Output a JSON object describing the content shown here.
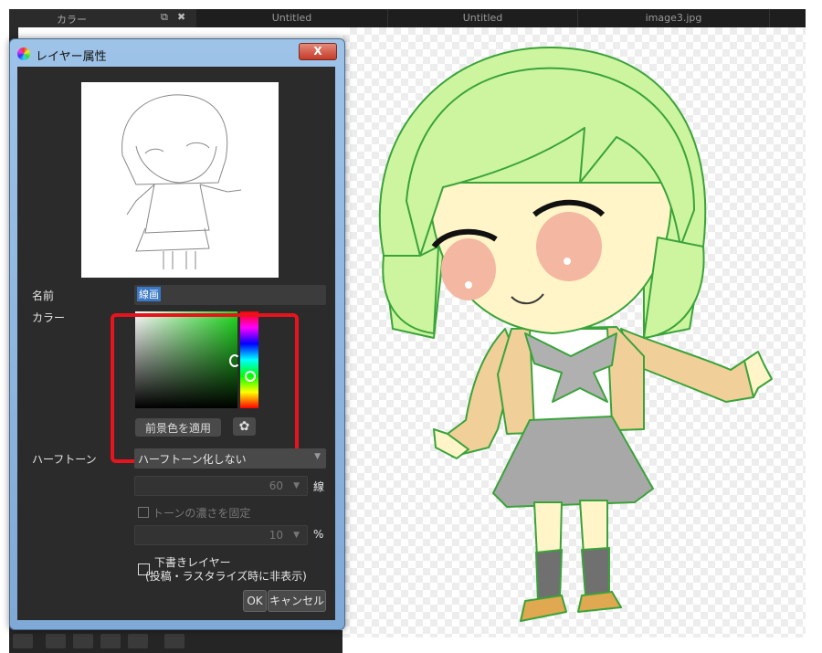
{
  "topbar": {
    "panel_title": "カラー",
    "tabs": [
      "Untitled",
      "Untitled",
      "image3.jpg"
    ]
  },
  "dialog": {
    "title": "レイヤー属性",
    "close_label": "X",
    "name_label": "名前",
    "name_value": "線画",
    "color_label": "カラー",
    "apply_fg_label": "前景色を適用",
    "palette_icon": "palette-icon",
    "halftone_label": "ハーフトーン",
    "halftone_value": "ハーフトーン化しない",
    "lines_value": "60",
    "lines_unit": "線",
    "fix_density_label": "トーンの濃さを固定",
    "density_value": "10",
    "density_unit": "%",
    "draft_layer_label": "下書きレイヤー",
    "draft_layer_note": "(投稿・ラスタライズ時に非表示)",
    "ok_label": "OK",
    "cancel_label": "キャンセル"
  },
  "colors": {
    "highlight": "#e8141d",
    "picker_hue": "#22dd22",
    "hair": "#cdf5a0",
    "skin": "#fff5c8",
    "eye": "#f3b7a2",
    "jacket": "#f0cf98",
    "skirt": "#a8a8a8",
    "socks": "#707070",
    "shoes": "#e0a850"
  }
}
